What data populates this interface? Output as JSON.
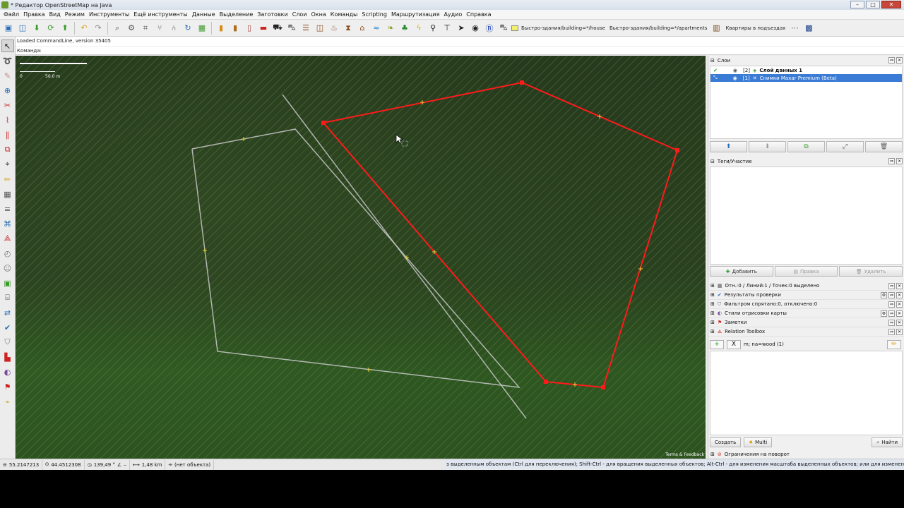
{
  "window": {
    "title": "* Редактор OpenStreetMap на Java",
    "minimize": "–",
    "maximize": "□",
    "close": "✕"
  },
  "menu": [
    "Файл",
    "Правка",
    "Вид",
    "Режим",
    "Инструменты",
    "Ещё инструменты",
    "Данные",
    "Выделение",
    "Заготовки",
    "Слои",
    "Окна",
    "Команды",
    "Scripting",
    "Маршрутизация",
    "Аудио",
    "Справка"
  ],
  "toolbar": {
    "preset_house": "Быстро-здания/building=*/house",
    "preset_apartments": "Быстро-здания/building=*/apartments",
    "entrances": "Квартиры в подъездах",
    "highlight_color": "#f2f06a"
  },
  "commandline": {
    "loaded": "Loaded CommandLine, version 35405",
    "prompt": "Команда:"
  },
  "map": {
    "scale_label": "50.0 m",
    "scale_zero": "0",
    "terms": "Terms & Feedback",
    "selected_way_color": "#ff1a1a",
    "other_way_color": "#c8c8c8"
  },
  "layers_panel": {
    "title": "Слои",
    "layers": [
      {
        "index": "[2]",
        "name": "Слой данных 1",
        "selected": false
      },
      {
        "index": "[1]",
        "name": "Снимки Maxar Premium (Beta)",
        "selected": true
      }
    ]
  },
  "tags_panel": {
    "title": "Теги/Участие",
    "add": "Добавить",
    "edit": "Правка",
    "delete": "Удалить"
  },
  "dialogs": [
    {
      "label": "Отн.:0 / Линий:1 / Точек:0 выделено",
      "icon": "selection-list-icon"
    },
    {
      "label": "Результаты проверки",
      "icon": "validation-icon"
    },
    {
      "label": "Фильтром спрятано:0, отключено:0",
      "icon": "filter-icon"
    },
    {
      "label": "Стили отрисовки карты",
      "icon": "map-style-icon"
    },
    {
      "label": "Заметки",
      "icon": "notes-icon"
    },
    {
      "label": "Relation Toolbox",
      "icon": "relation-toolbox-icon"
    }
  ],
  "filter": {
    "add": "+",
    "remove": "X",
    "text": "m; na=wood (1)"
  },
  "bottom_buttons": {
    "create": "Создать",
    "multi": "Multi",
    "find": "Найти"
  },
  "restrictions": "Ограничения на поворот",
  "status": {
    "lat": "55.2147213",
    "lon": "44.4512308",
    "heading": "139,49 °",
    "angle": "–",
    "distance": "1,48 km",
    "object": "(нет объекта)",
    "message": "з выделенным объектам (Ctrl для переключения); Shift-Ctrl - для вращения выделенных объектов; Alt-Ctrl - для изменения масштаба выделенных объектов; или для изменения выделения"
  }
}
